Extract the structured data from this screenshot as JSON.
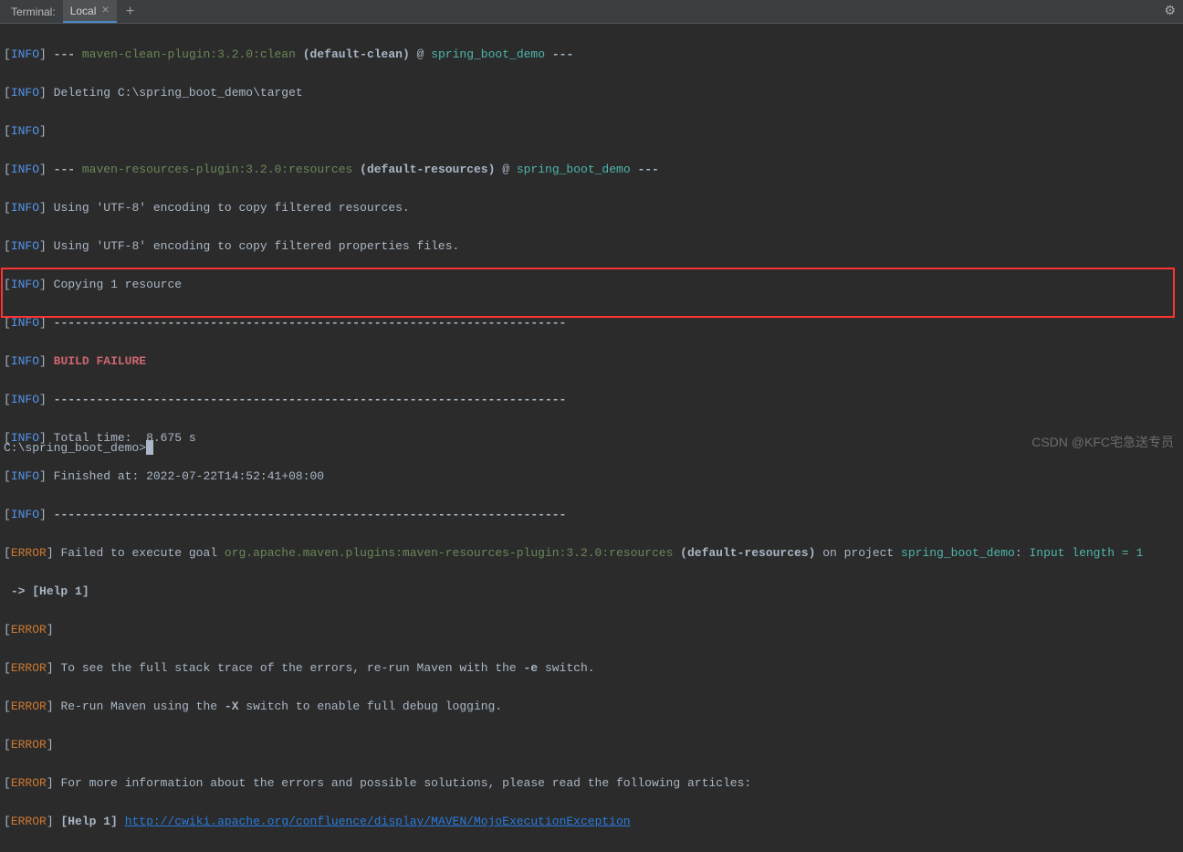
{
  "tabbar": {
    "label": "Terminal:",
    "tab_name": "Local",
    "close": "×",
    "add": "+"
  },
  "lines": {
    "l1_plugin": "maven-clean-plugin:3.2.0:clean",
    "l1_goal": "(default-clean)",
    "l1_at": "@",
    "l1_project": "spring_boot_demo",
    "l2": "Deleting C:\\spring_boot_demo\\target",
    "l4_plugin": "maven-resources-plugin:3.2.0:resources",
    "l4_goal": "(default-resources)",
    "l4_at": "@",
    "l4_project": "spring_boot_demo",
    "l5": "Using 'UTF-8' encoding to copy filtered resources.",
    "l6": "Using 'UTF-8' encoding to copy filtered properties files.",
    "l7": "Copying 1 resource",
    "divider": "------------------------------------------------------------------------",
    "build_failure": "BUILD FAILURE",
    "total_time": "Total time:  8.675 s",
    "finished_at": "Finished at: 2022-07-22T14:52:41+08:00",
    "err1_pre": "Failed to execute goal ",
    "err1_plugin": "org.apache.maven.plugins:maven-resources-plugin:3.2.0:resources",
    "err1_goal": " (default-resources)",
    "err1_on": " on project ",
    "err1_project": "spring_boot_demo",
    "err1_colon": ": ",
    "err1_input": "Input length = 1",
    "err1_help": "-> [Help 1]",
    "err3_pre": "To see the full stack trace of the errors, re-run Maven with the ",
    "err3_flag": "-e",
    "err3_post": " switch.",
    "err4_pre": "Re-run Maven using the ",
    "err4_flag": "-X",
    "err4_post": " switch to enable full debug logging.",
    "err6": "For more information about the errors and possible solutions, please read the following articles:",
    "err7_help": "[Help 1]",
    "err7_link": "http://cwiki.apache.org/confluence/display/MAVEN/MojoExecutionException"
  },
  "labels": {
    "info": "INFO",
    "error": "ERROR",
    "dashes": "---"
  },
  "prompt": "C:\\spring_boot_demo>",
  "watermark": "CSDN @KFC宅急送专员"
}
